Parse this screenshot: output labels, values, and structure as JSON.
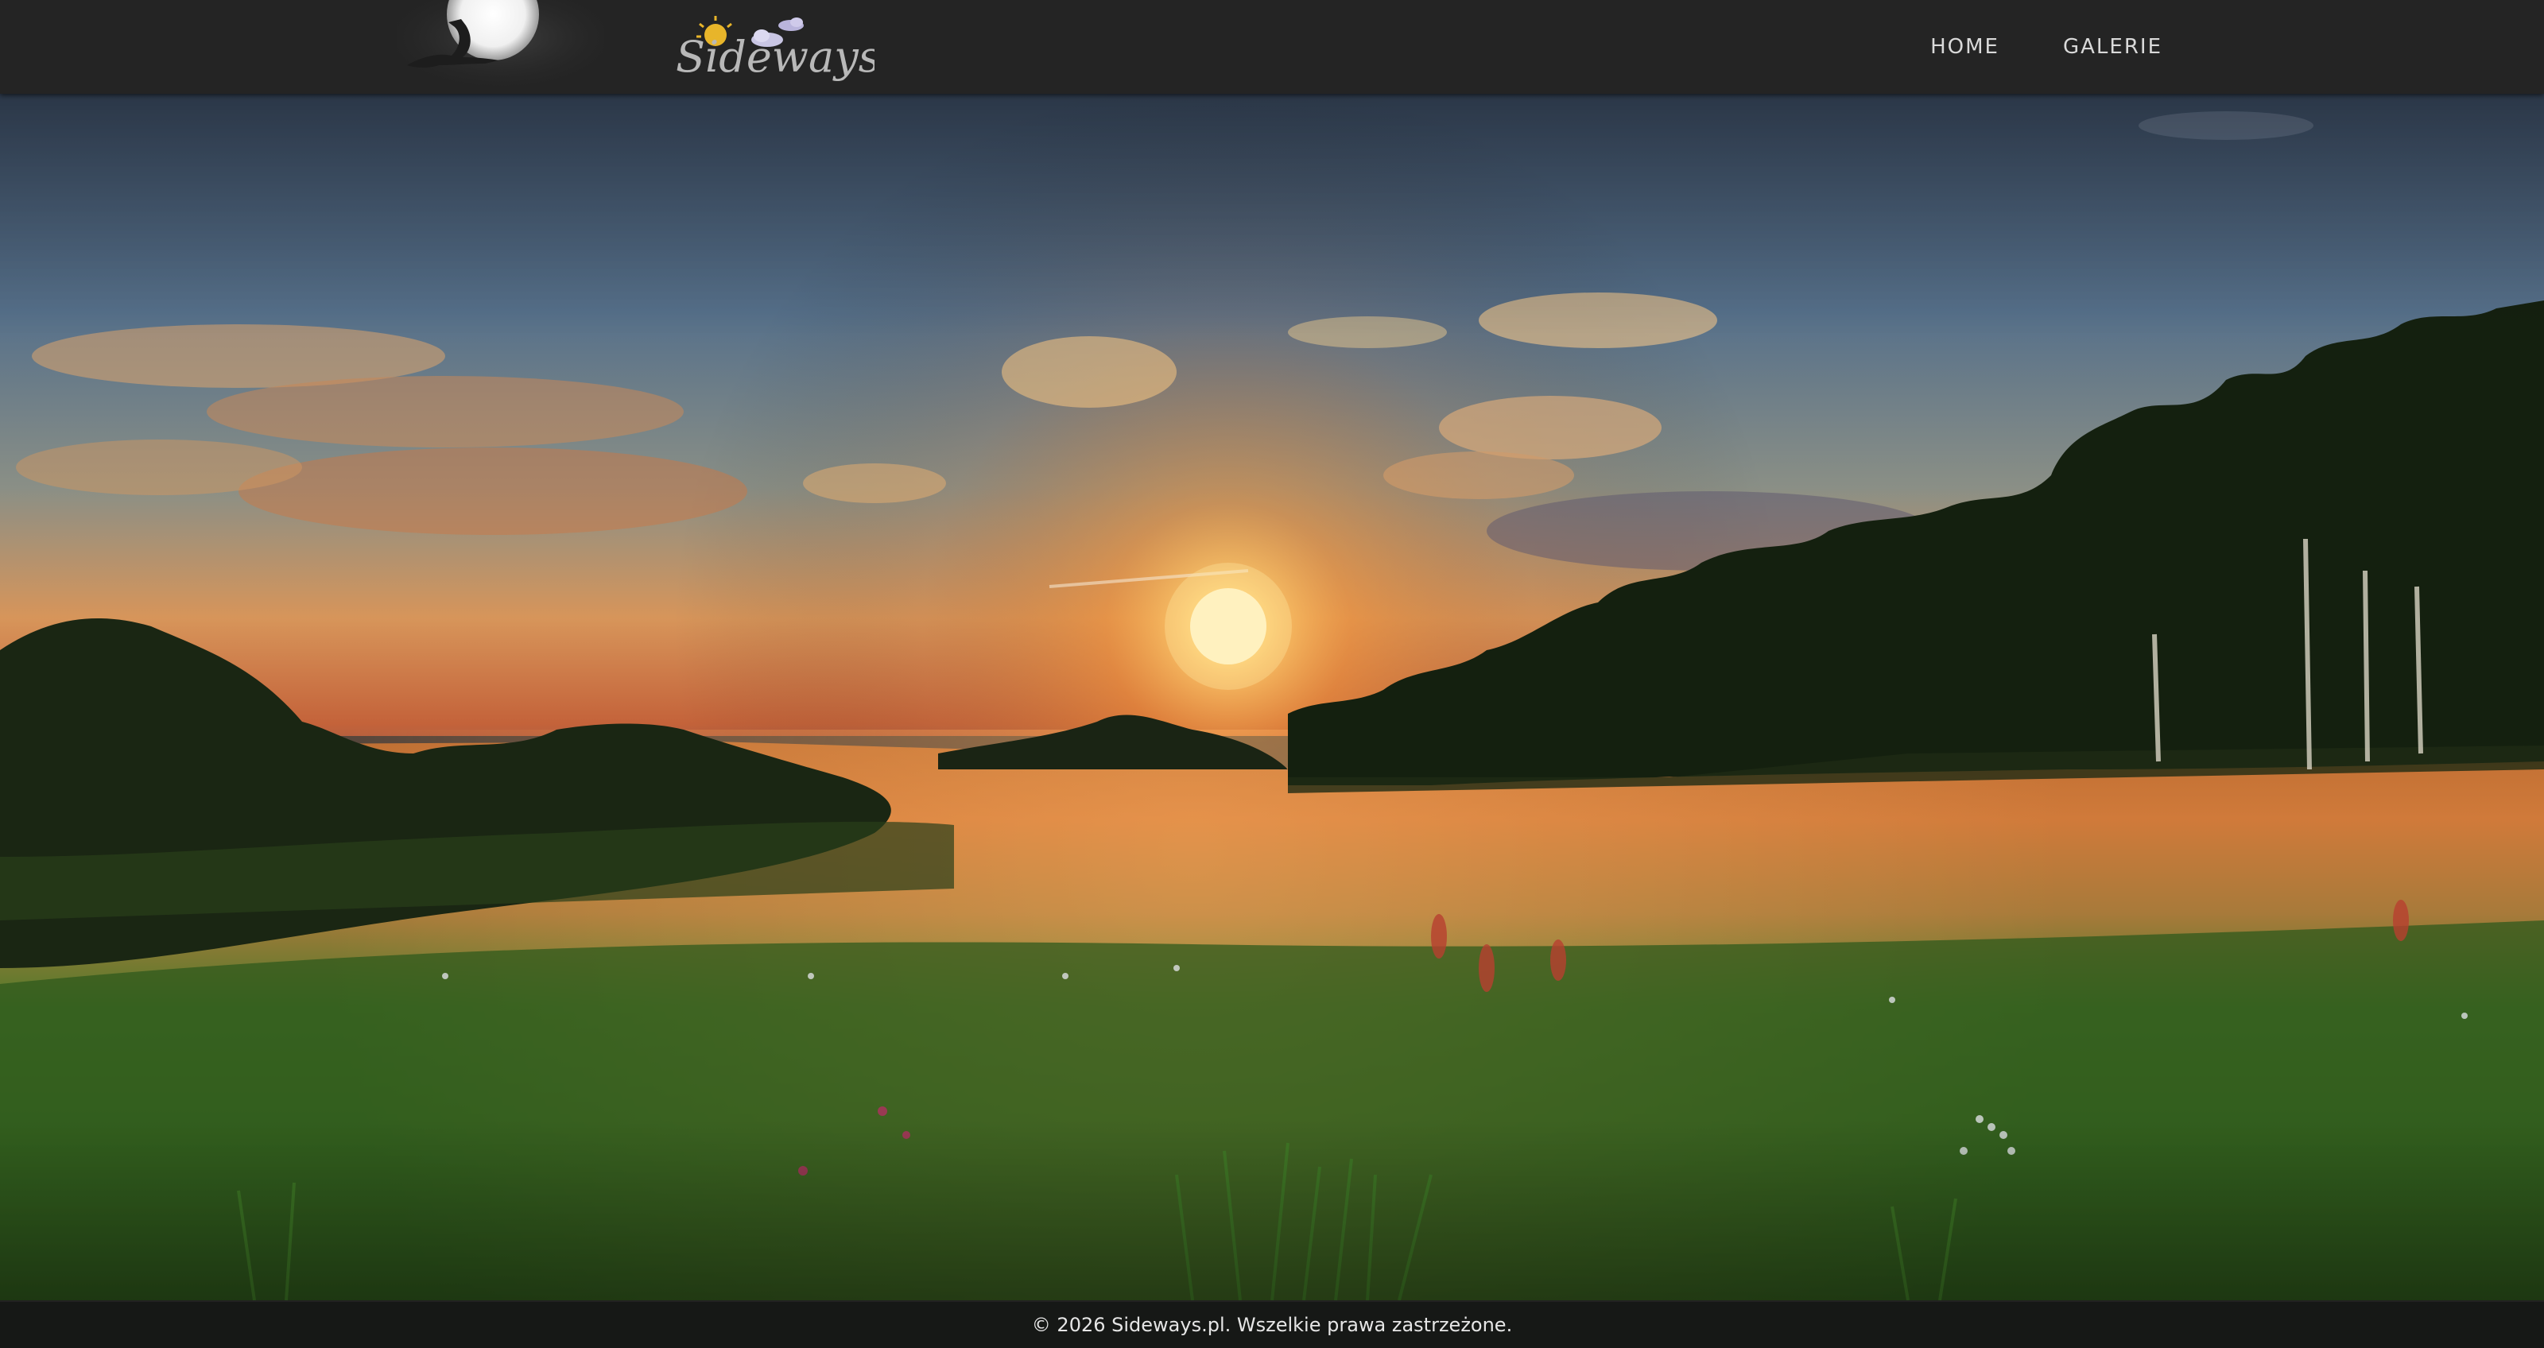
{
  "header": {
    "logo": {
      "text": "Sideways"
    },
    "nav": [
      {
        "label": "HOME"
      },
      {
        "label": "GALERIE"
      }
    ]
  },
  "hero": {
    "description": "Sunset over an orange meadow with a forest edge on the right",
    "icon": "landscape-photo"
  },
  "footer": {
    "copyright": "© 2026 Sideways.pl. Wszelkie prawa zastrzeżone."
  },
  "colors": {
    "header_bg": "#242424",
    "nav_text": "#d9d9d9",
    "logo_text": "#b8b8b8",
    "sun": "#ffe9a0"
  }
}
